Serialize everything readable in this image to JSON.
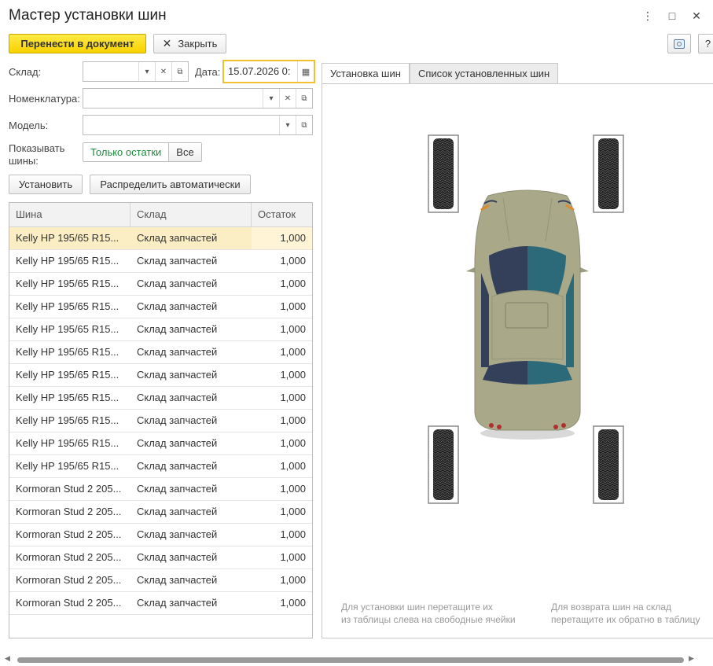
{
  "window": {
    "title": "Мастер установки шин"
  },
  "toolbar": {
    "transfer_label": "Перенести в документ",
    "close_label": "Закрыть",
    "help_label": "?"
  },
  "filters": {
    "warehouse_label": "Склад:",
    "warehouse_value": "",
    "date_label": "Дата:",
    "date_value": "15.07.2026  0:",
    "nomenclature_label": "Номенклатура:",
    "nomenclature_value": "",
    "model_label": "Модель:",
    "model_value": "",
    "show_label": "Показывать шины:",
    "show_options": [
      "Только остатки",
      "Все"
    ],
    "show_selected": "Только остатки"
  },
  "actions": {
    "install_label": "Установить",
    "auto_label": "Распределить автоматически"
  },
  "table": {
    "columns": [
      "Шина",
      "Склад",
      "Остаток"
    ],
    "rows": [
      [
        "Kelly HP 195/65 R15...",
        "Склад запчастей",
        "1,000"
      ],
      [
        "Kelly HP 195/65 R15...",
        "Склад запчастей",
        "1,000"
      ],
      [
        "Kelly HP 195/65 R15...",
        "Склад запчастей",
        "1,000"
      ],
      [
        "Kelly HP 195/65 R15...",
        "Склад запчастей",
        "1,000"
      ],
      [
        "Kelly HP 195/65 R15...",
        "Склад запчастей",
        "1,000"
      ],
      [
        "Kelly HP 195/65 R15...",
        "Склад запчастей",
        "1,000"
      ],
      [
        "Kelly HP 195/65 R15...",
        "Склад запчастей",
        "1,000"
      ],
      [
        "Kelly HP 195/65 R15...",
        "Склад запчастей",
        "1,000"
      ],
      [
        "Kelly HP 195/65 R15...",
        "Склад запчастей",
        "1,000"
      ],
      [
        "Kelly HP 195/65 R15...",
        "Склад запчастей",
        "1,000"
      ],
      [
        "Kelly HP 195/65 R15...",
        "Склад запчастей",
        "1,000"
      ],
      [
        "Kormoran Stud 2 205...",
        "Склад запчастей",
        "1,000"
      ],
      [
        "Kormoran Stud 2 205...",
        "Склад запчастей",
        "1,000"
      ],
      [
        "Kormoran Stud 2 205...",
        "Склад запчастей",
        "1,000"
      ],
      [
        "Kormoran Stud 2 205...",
        "Склад запчастей",
        "1,000"
      ],
      [
        "Kormoran Stud 2 205...",
        "Склад запчастей",
        "1,000"
      ],
      [
        "Kormoran Stud 2 205...",
        "Склад запчастей",
        "1,000"
      ]
    ],
    "selected_row": 0
  },
  "tabs": [
    "Установка шин",
    "Список установленных шин"
  ],
  "active_tab": 0,
  "hints": {
    "install": [
      "Для установки шин перетащите их",
      "из таблицы слева на свободные ячейки"
    ],
    "return": [
      "Для возврата шин на склад",
      "перетащите их обратно в таблицу"
    ]
  },
  "colors": {
    "primary_button": "#f8d300",
    "selected_row": "#fbeec4",
    "car_body": "#a9a98a",
    "window_dark": "#34405a",
    "window_teal": "#2c6a7a"
  },
  "icons": [
    "more-vertical-icon",
    "maximize-icon",
    "close-icon",
    "camera-icon",
    "calendar-icon",
    "dropdown-icon",
    "clear-icon",
    "open-icon"
  ]
}
